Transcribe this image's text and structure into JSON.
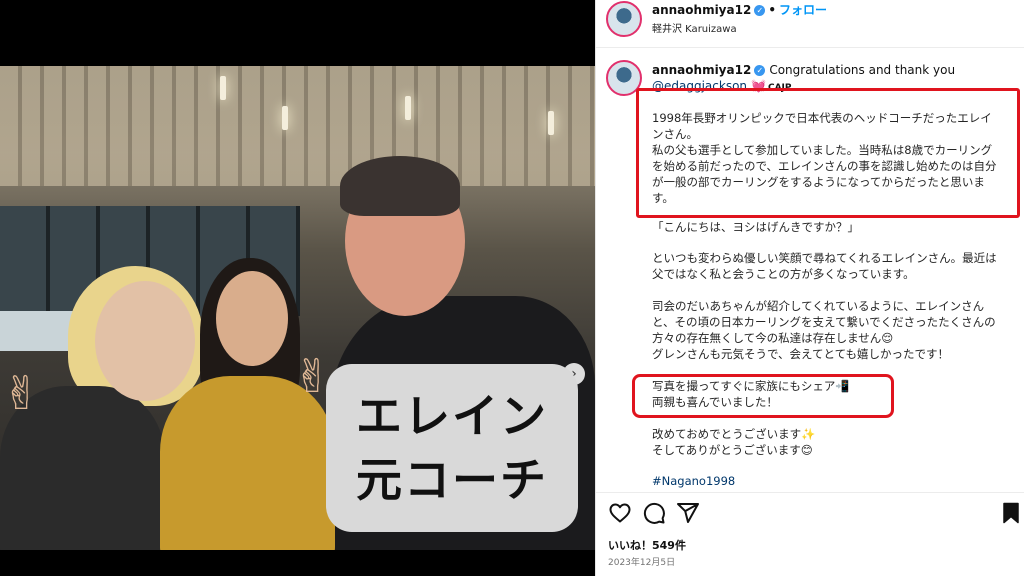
{
  "photo": {
    "caption_lines": [
      "エレイン",
      "元コーチ"
    ],
    "carousel": {
      "total": 2,
      "active": 1
    }
  },
  "post": {
    "header": {
      "username": "annaohmiya12",
      "follow_label": "フォロー",
      "separator": "•",
      "location": "軽井沢 Karuizawa"
    },
    "caption": {
      "username": "annaohmiya12",
      "first_line": "Congratulations and thank you",
      "mention": "@edaggjackson",
      "heart": "💓",
      "badge": "CAJP",
      "paragraphs": [
        "1998年長野オリンピックで日本代表のヘッドコーチだったエレインさん。\n私の父も選手として参加していました。当時私は8歳でカーリングを始める前だったので、エレインさんの事を認識し始めたのは自分が一般の部でカーリングをするようになってからだったと思います。",
        "「こんにちは、ヨシはげんきですか？」",
        "といつも変わらぬ優しい笑顔で尋ねてくれるエレインさん。最近は父ではなく私と会うことの方が多くなっています。",
        "司会のだいあちゃんが紹介してくれているように、エレインさんと、その頃の日本カーリングを支えて繋いでくださったたくさんの方々の存在無くして今の私達は存在しません😌\nグレンさんも元気そうで、会えてとても嬉しかったです！",
        "写真を撮ってすぐに家族にもシェア📲\n両親も喜んでいました！",
        "改めておめでとうございます✨\nそしてありがとうございます😊"
      ],
      "hashtag": "#Nagano1998"
    },
    "likes": "いいね！549件",
    "date": "2023年12月5日",
    "icons": [
      "heart-icon",
      "comment-icon",
      "share-icon",
      "bookmark-icon",
      "verified-icon",
      "next-arrow-icon"
    ],
    "colors": {
      "highlight_box": "#e0141e",
      "link": "#00376b",
      "follow": "#0095f6"
    }
  }
}
